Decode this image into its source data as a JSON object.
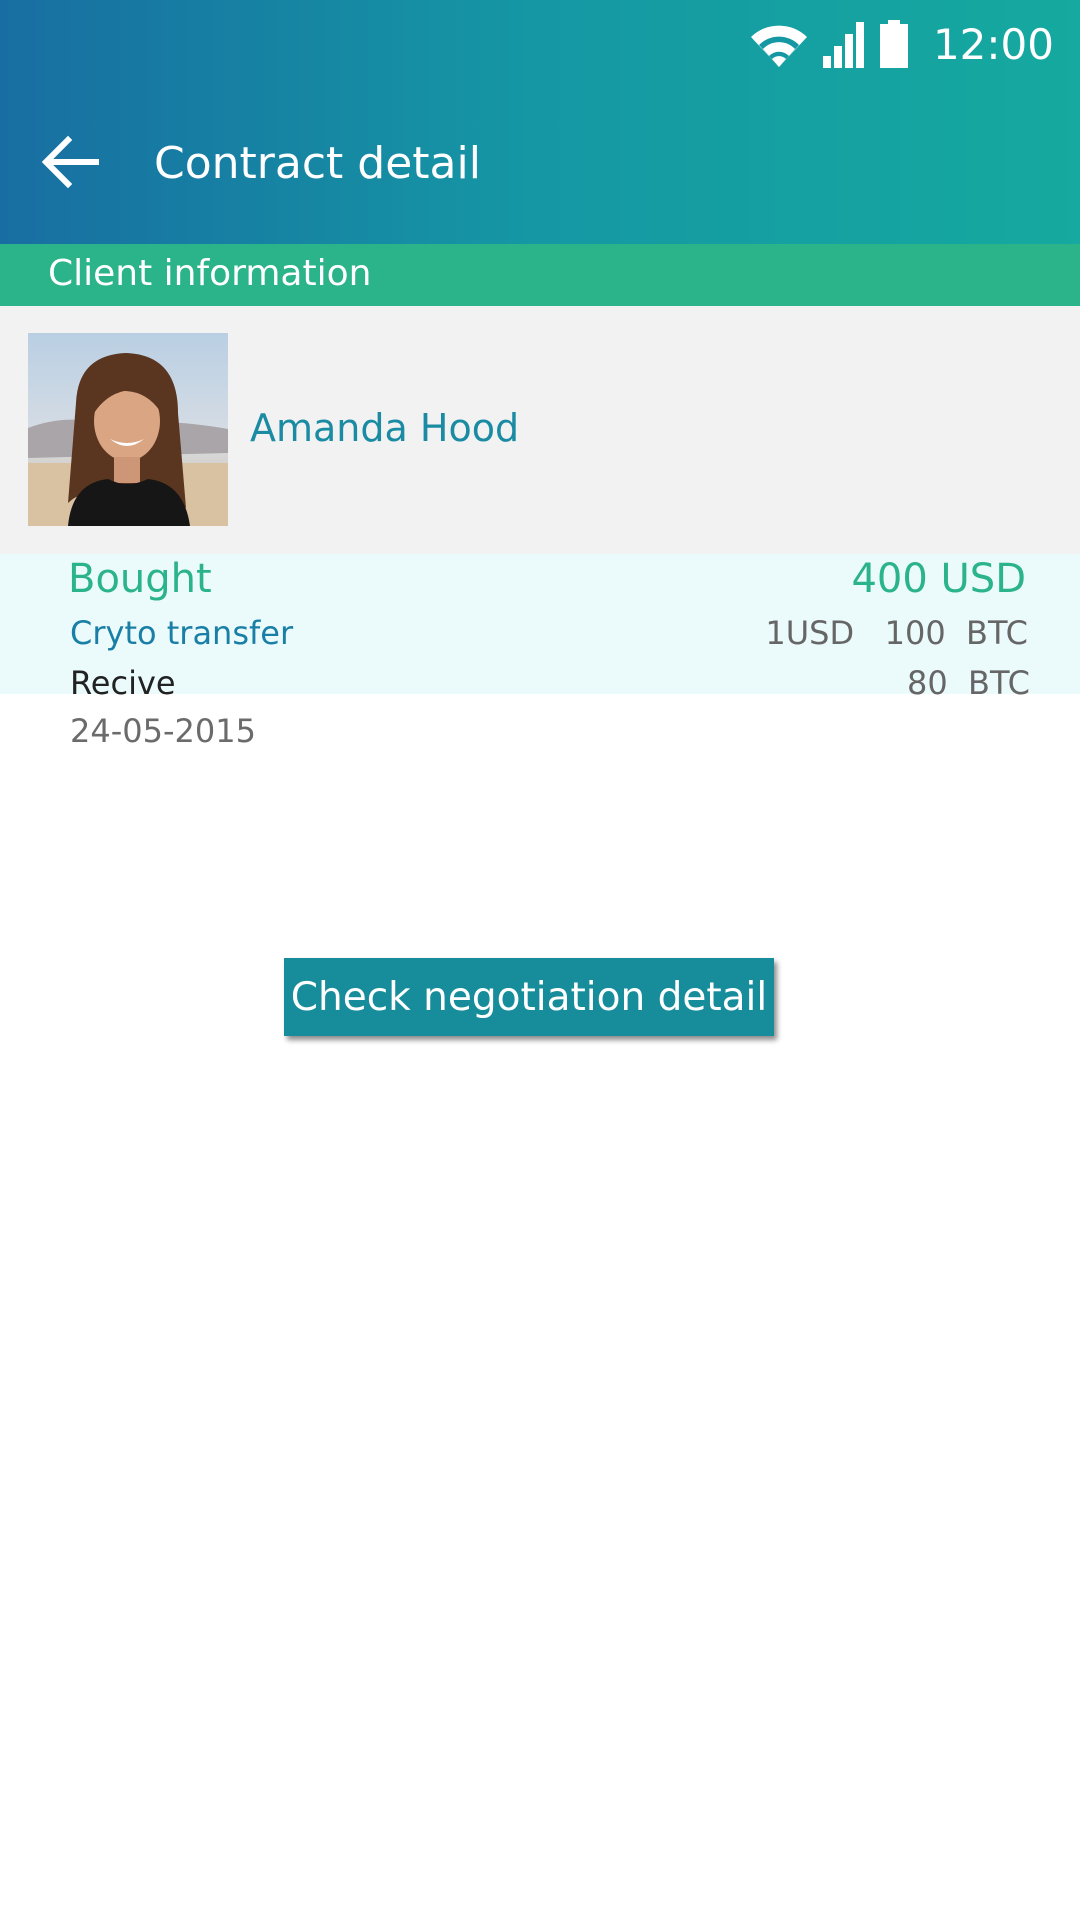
{
  "colors": {
    "header_start": "#186ea2",
    "header_end": "#15a99f",
    "section_strip": "#2bb38a",
    "client_name": "#1a8ba3",
    "accent_green": "#2bb38a",
    "transfer_blue": "#1a7fa6",
    "button": "#178d9c"
  },
  "status_bar": {
    "time": "12:00",
    "icons": [
      "wifi-icon",
      "cell-signal-icon",
      "battery-icon"
    ]
  },
  "app_bar": {
    "back_icon": "arrow-left-icon",
    "title": "Contract detail"
  },
  "section": {
    "title": "Client information"
  },
  "client": {
    "name": "Amanda Hood"
  },
  "transaction": {
    "bought_label": "Bought",
    "bought_value": "400 USD",
    "transfer_label": "Cryto transfer",
    "transfer_value": "1USD   100  BTC",
    "receive_label": "Recive",
    "receive_value": "80  BTC",
    "date": "24-05-2015"
  },
  "actions": {
    "check_negotiation_label": "Check negotiation detail"
  }
}
